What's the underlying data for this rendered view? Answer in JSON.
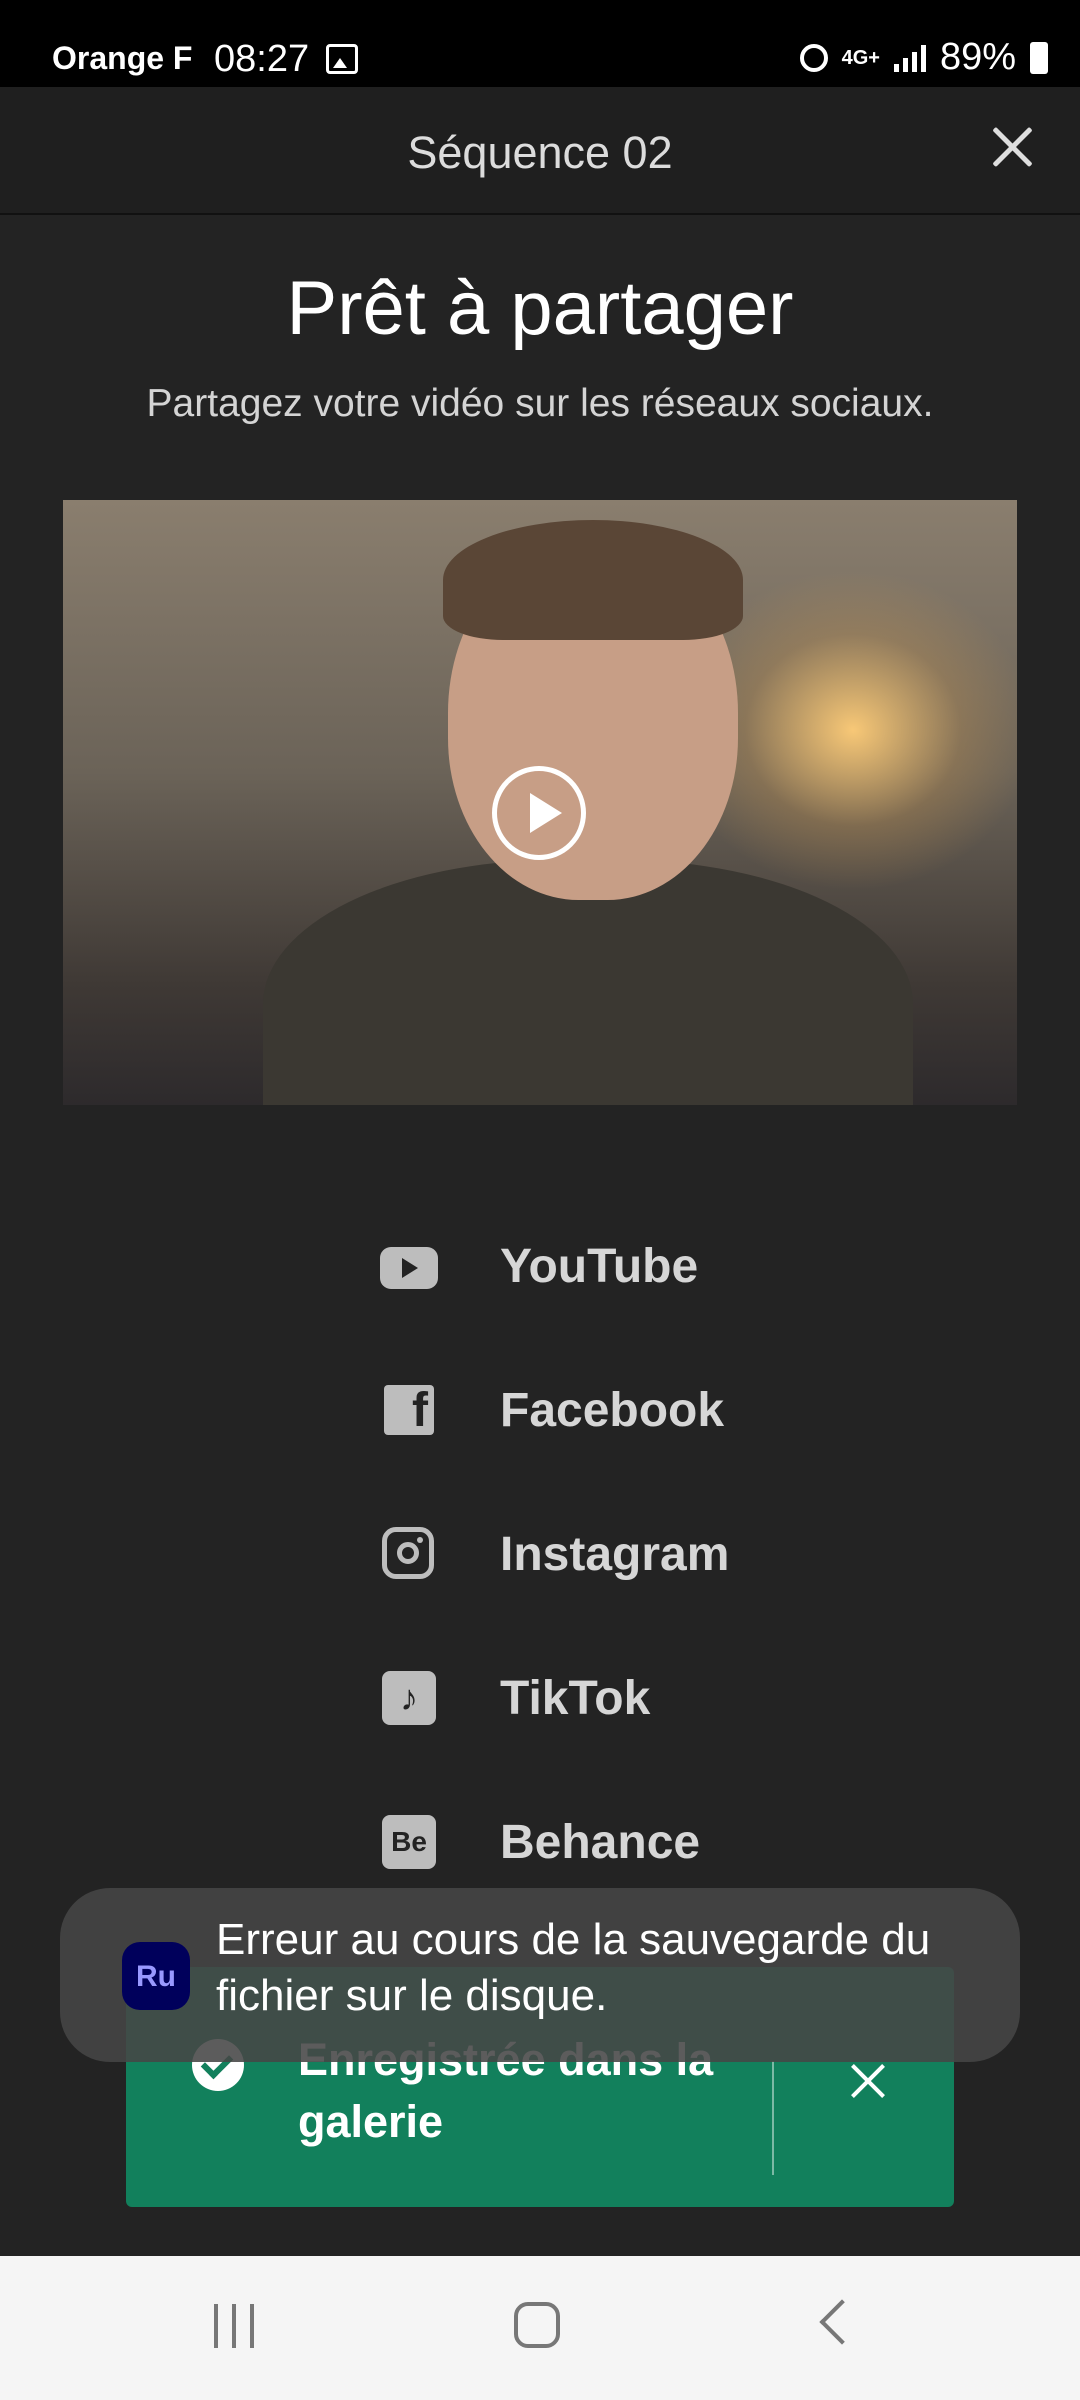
{
  "status_bar": {
    "carrier": "Orange F",
    "time": "08:27",
    "network": "4G+",
    "battery": "89%"
  },
  "header": {
    "title": "Séquence  02",
    "close_icon": "close-icon"
  },
  "main": {
    "title": "Prêt à partager",
    "subtitle": "Partagez votre vidéo sur les réseaux sociaux."
  },
  "share": {
    "items": [
      {
        "label": "YouTube",
        "icon": "youtube-icon"
      },
      {
        "label": "Facebook",
        "icon": "facebook-icon"
      },
      {
        "label": "Instagram",
        "icon": "instagram-icon"
      },
      {
        "label": "TikTok",
        "icon": "tiktok-icon"
      },
      {
        "label": "Behance",
        "icon": "behance-icon"
      }
    ]
  },
  "saved_banner": {
    "text": "Enregistrée dans la galerie"
  },
  "toast": {
    "app_badge": "Ru",
    "message": "Erreur au cours de la sauvegarde du fichier sur le disque."
  },
  "colors": {
    "background": "#232323",
    "banner_green": "#12805c",
    "toast_bg": "#464646",
    "app_badge": "#00005b"
  }
}
